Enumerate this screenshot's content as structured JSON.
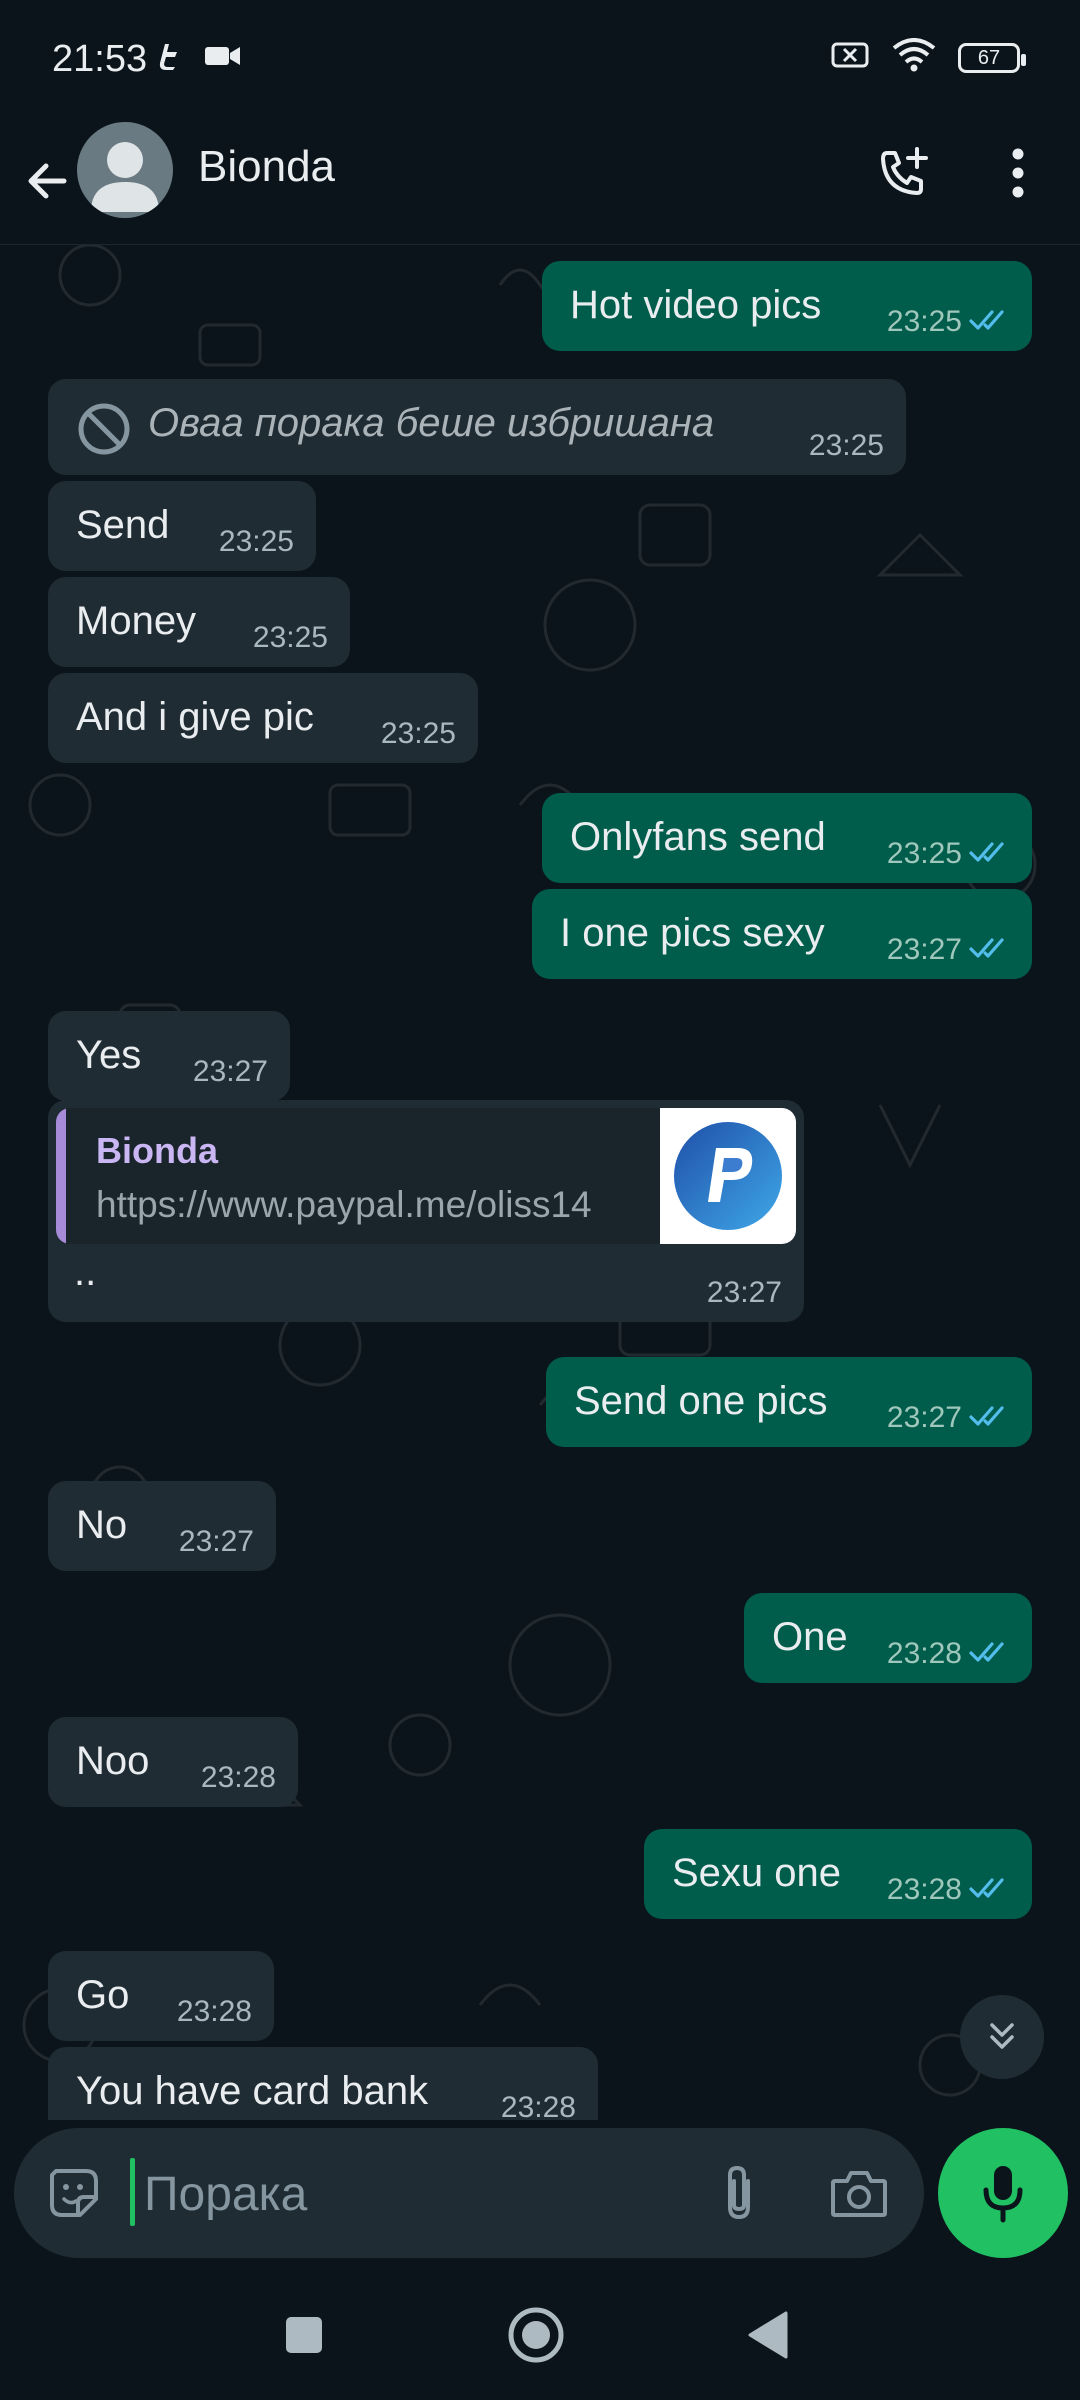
{
  "status_bar": {
    "time": "21:53",
    "battery": "67"
  },
  "header": {
    "contact_name": "Bionda"
  },
  "messages": [
    {
      "direction": "out",
      "text": "Hot video pics",
      "time": "23:25",
      "read": true
    },
    {
      "direction": "in",
      "deleted": true,
      "text": "Оваа порака беше избришана",
      "time": "23:25"
    },
    {
      "direction": "in",
      "text": "Send",
      "time": "23:25"
    },
    {
      "direction": "in",
      "text": "Money",
      "time": "23:25"
    },
    {
      "direction": "in",
      "text": "And i give pic",
      "time": "23:25"
    },
    {
      "direction": "out",
      "text": "Onlyfans send",
      "time": "23:25",
      "read": true
    },
    {
      "direction": "out",
      "text": "I one pics sexy",
      "time": "23:27",
      "read": true
    },
    {
      "direction": "in",
      "text": "Yes",
      "time": "23:27"
    },
    {
      "direction": "in",
      "link_preview": {
        "title": "Bionda",
        "url": "https://www.paypal.me/oliss14"
      },
      "text": "..",
      "time": "23:27"
    },
    {
      "direction": "out",
      "text": "Send one pics",
      "time": "23:27",
      "read": true
    },
    {
      "direction": "in",
      "text": "No",
      "time": "23:27"
    },
    {
      "direction": "out",
      "text": "One",
      "time": "23:28",
      "read": true
    },
    {
      "direction": "in",
      "text": "Noo",
      "time": "23:28"
    },
    {
      "direction": "out",
      "text": "Sexu one",
      "time": "23:28",
      "read": true
    },
    {
      "direction": "in",
      "text": "Go",
      "time": "23:28"
    },
    {
      "direction": "in",
      "text": "You have card bank",
      "time": "23:28"
    }
  ],
  "composer": {
    "placeholder": "Порака"
  },
  "colors": {
    "accent": "#21c063",
    "outgoing_bubble": "#005c4b",
    "incoming_bubble": "#202c33",
    "read_tick": "#53bdeb"
  }
}
